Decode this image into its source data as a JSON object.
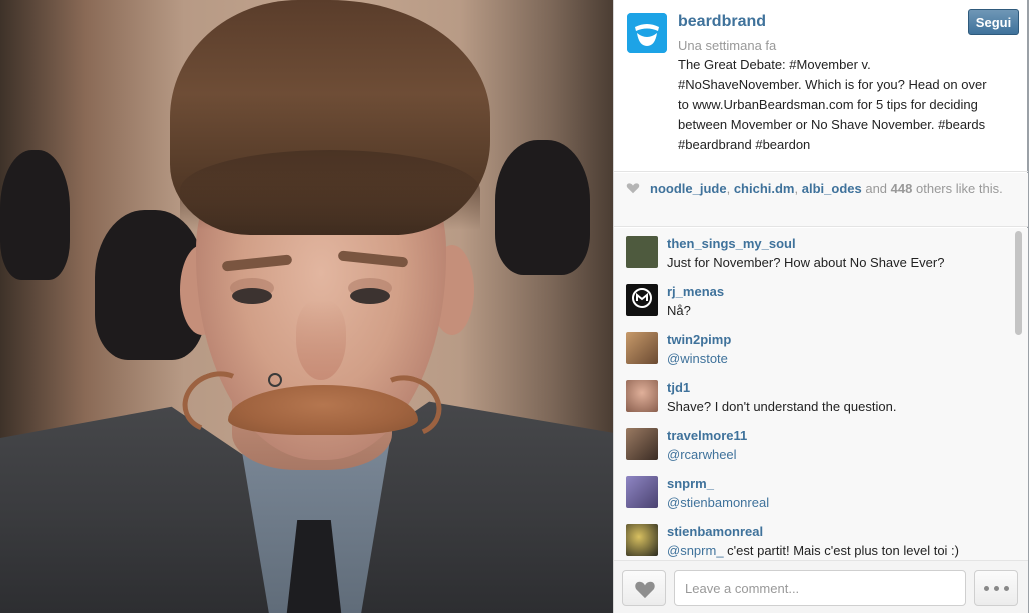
{
  "post": {
    "author": "beardbrand",
    "follow_label": "Segui",
    "timestamp": "Una settimana fa",
    "caption_lines": [
      "The Great Debate: #Movember v.",
      "#NoShaveNovember. Which is for you? Head on over",
      "to www.UrbanBeardsman.com for 5 tips for deciding",
      "between Movember or No Shave November. #beards",
      "#beardbrand #beardon"
    ],
    "accent_color": "#3f729b"
  },
  "likes": {
    "users": [
      "noodle_jude",
      "chichi.dm",
      "albi_odes"
    ],
    "sep": ",",
    "and": "and",
    "count": "448",
    "suffix": "others like this."
  },
  "comments": [
    {
      "user": "then_sings_my_soul",
      "mention": "",
      "text": "Just for November? How about No Shave Ever?",
      "avatar_color": "#4e5a3e"
    },
    {
      "user": "rj_menas",
      "mention": "",
      "text": "Nå?",
      "avatar_color": "#111111"
    },
    {
      "user": "twin2pimp",
      "mention": "@winstote",
      "text": "",
      "avatar_color": "#8a5a3a"
    },
    {
      "user": "tjd1",
      "mention": "",
      "text": "Shave? I don't understand the question.",
      "avatar_color": "#b07a62"
    },
    {
      "user": "travelmore11",
      "mention": "@rcarwheel",
      "text": "",
      "avatar_color": "#6b4a3a"
    },
    {
      "user": "snprm_",
      "mention": "@stienbamonreal",
      "text": "",
      "avatar_color": "#7a6fa0"
    },
    {
      "user": "stienbamonreal",
      "mention": "@snprm_",
      "text": " c'est partit! Mais c'est plus ton level toi :)",
      "avatar_color": "#3a3a2a"
    }
  ],
  "footer": {
    "comment_placeholder": "Leave a comment..."
  }
}
